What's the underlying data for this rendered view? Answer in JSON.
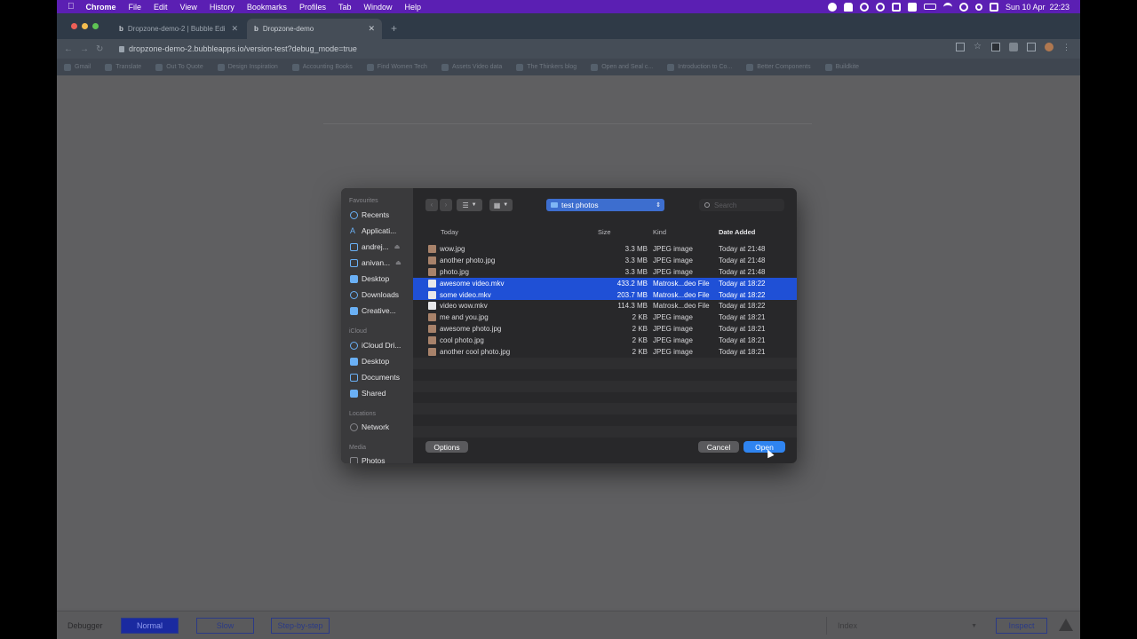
{
  "menubar": {
    "app": "Chrome",
    "items": [
      "File",
      "Edit",
      "View",
      "History",
      "Bookmarks",
      "Profiles",
      "Tab",
      "Window",
      "Help"
    ],
    "datetime": "Sun 10 Apr  22:23"
  },
  "tabs": [
    {
      "label": "Dropzone-demo-2 | Bubble Edi"
    },
    {
      "label": "Dropzone-demo"
    }
  ],
  "address": {
    "url": "dropzone-demo-2.bubbleapps.io/version-test?debug_mode=true"
  },
  "bookmarks": [
    "Gmail",
    "Translate",
    "Out To Quote",
    "Design Inspiration",
    "Accounting Books",
    "Find Women Tech",
    "Assets Video data",
    "The Thinkers blog",
    "Open and Seal c...",
    "Introduction to Co...",
    "Better Components",
    "Buildkite"
  ],
  "dialog": {
    "sidebar": {
      "favourites_label": "Favourites",
      "favourites": [
        "Recents",
        "Applicati...",
        "andrej...",
        "anivan...",
        "Desktop",
        "Downloads",
        "Creative..."
      ],
      "icloud_label": "iCloud",
      "icloud": [
        "iCloud Dri...",
        "Desktop",
        "Documents",
        "Shared"
      ],
      "locations_label": "Locations",
      "locations": [
        "Network"
      ],
      "media_label": "Media",
      "media": [
        "Photos"
      ]
    },
    "folder": "test photos",
    "search_placeholder": "Search",
    "columns": {
      "name": "Today",
      "size": "Size",
      "kind": "Kind",
      "date": "Date Added"
    },
    "files": [
      {
        "name": "wow.jpg",
        "size": "3.3 MB",
        "kind": "JPEG image",
        "date": "Today at 21:48",
        "selected": false,
        "icon": "image-icon"
      },
      {
        "name": "another photo.jpg",
        "size": "3.3 MB",
        "kind": "JPEG image",
        "date": "Today at 21:48",
        "selected": false,
        "icon": "image-icon"
      },
      {
        "name": "photo.jpg",
        "size": "3.3 MB",
        "kind": "JPEG image",
        "date": "Today at 21:48",
        "selected": false,
        "icon": "image-icon"
      },
      {
        "name": "awesome video.mkv",
        "size": "433.2 MB",
        "kind": "Matrosk...deo File",
        "date": "Today at 18:22",
        "selected": true,
        "icon": "video-file-icon"
      },
      {
        "name": "some video.mkv",
        "size": "203.7 MB",
        "kind": "Matrosk...deo File",
        "date": "Today at 18:22",
        "selected": true,
        "icon": "video-file-icon"
      },
      {
        "name": "video wow.mkv",
        "size": "114.3 MB",
        "kind": "Matrosk...deo File",
        "date": "Today at 18:22",
        "selected": false,
        "icon": "video-file-icon"
      },
      {
        "name": "me and you.jpg",
        "size": "2 KB",
        "kind": "JPEG image",
        "date": "Today at 18:21",
        "selected": false,
        "icon": "image-icon"
      },
      {
        "name": "awesome photo.jpg",
        "size": "2 KB",
        "kind": "JPEG image",
        "date": "Today at 18:21",
        "selected": false,
        "icon": "image-icon"
      },
      {
        "name": "cool photo.jpg",
        "size": "2 KB",
        "kind": "JPEG image",
        "date": "Today at 18:21",
        "selected": false,
        "icon": "image-icon"
      },
      {
        "name": "another cool photo.jpg",
        "size": "2 KB",
        "kind": "JPEG image",
        "date": "Today at 18:21",
        "selected": false,
        "icon": "image-icon"
      }
    ],
    "buttons": {
      "options": "Options",
      "cancel": "Cancel",
      "open": "Open"
    }
  },
  "debugger": {
    "label": "Debugger",
    "modes": [
      "Normal",
      "Slow",
      "Step-by-step"
    ],
    "active_mode": "Normal",
    "index_select": "Index",
    "inspect": "Inspect"
  },
  "colors": {
    "menubar": "#5b1fb3",
    "selection": "#1f50d6",
    "open_button": "#2f84f0",
    "debugger_active": "#1a2aa0"
  }
}
